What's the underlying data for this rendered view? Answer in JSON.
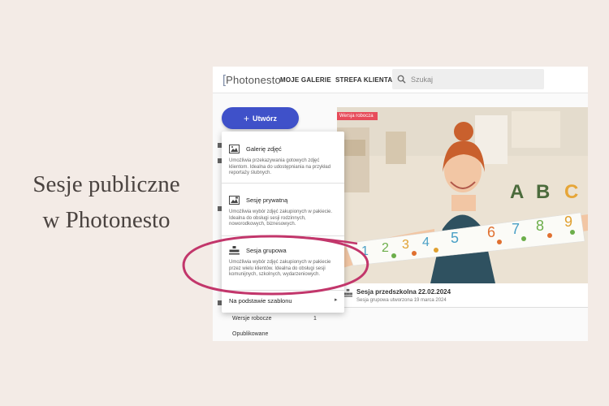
{
  "headline": {
    "line1": "Sesje publiczne",
    "line2": "w Photonesto"
  },
  "header": {
    "logo_text": "Photonesto",
    "logo_bracket": "[",
    "nav": [
      "MOJE GALERIE",
      "STREFA KLIENTA"
    ],
    "search_placeholder": "Szukaj"
  },
  "sidebar": {
    "create_label": "Utwórz",
    "create_plus": "+",
    "rows": [
      {
        "label": "Wersje robocze",
        "count": "1"
      },
      {
        "label": "Opublikowane",
        "count": ""
      }
    ]
  },
  "gallery_card": {
    "badge": "Wersja robocza",
    "title": "Sesja przedszkolna 22.02.2024",
    "subtitle": "Sesja grupowa utworzona 19 marca 2024"
  },
  "create_menu": {
    "items": [
      {
        "title": "Galerię zdjęć",
        "desc": "Umożliwia przekazywania gotowych zdjęć klientom. Idealna do udostępniania na przykład reportaży ślubnych.",
        "icon": "image-gallery-icon"
      },
      {
        "title": "Sesję prywatną",
        "desc": "Umożliwia wybór zdjęć zakupionych w pakiecie. Idealna do obsługi sesji rodzinnych, noworodkowych, biznesowych.",
        "icon": "private-session-icon"
      },
      {
        "title": "Sesja grupowa",
        "desc": "Umożliwia wybór zdjęć zakupionych w pakiecie przez wielu klientów. Idealna do obsługi sesji komunijnych, szkolnych, wydarzeniowych.",
        "icon": "group-session-icon"
      }
    ],
    "template_label": "Na podstawie szablonu",
    "template_arrow": "▸"
  },
  "colors": {
    "accent": "#3f51c9",
    "highlight_ring": "#c2366b",
    "draft_badge": "#e74c5a"
  }
}
